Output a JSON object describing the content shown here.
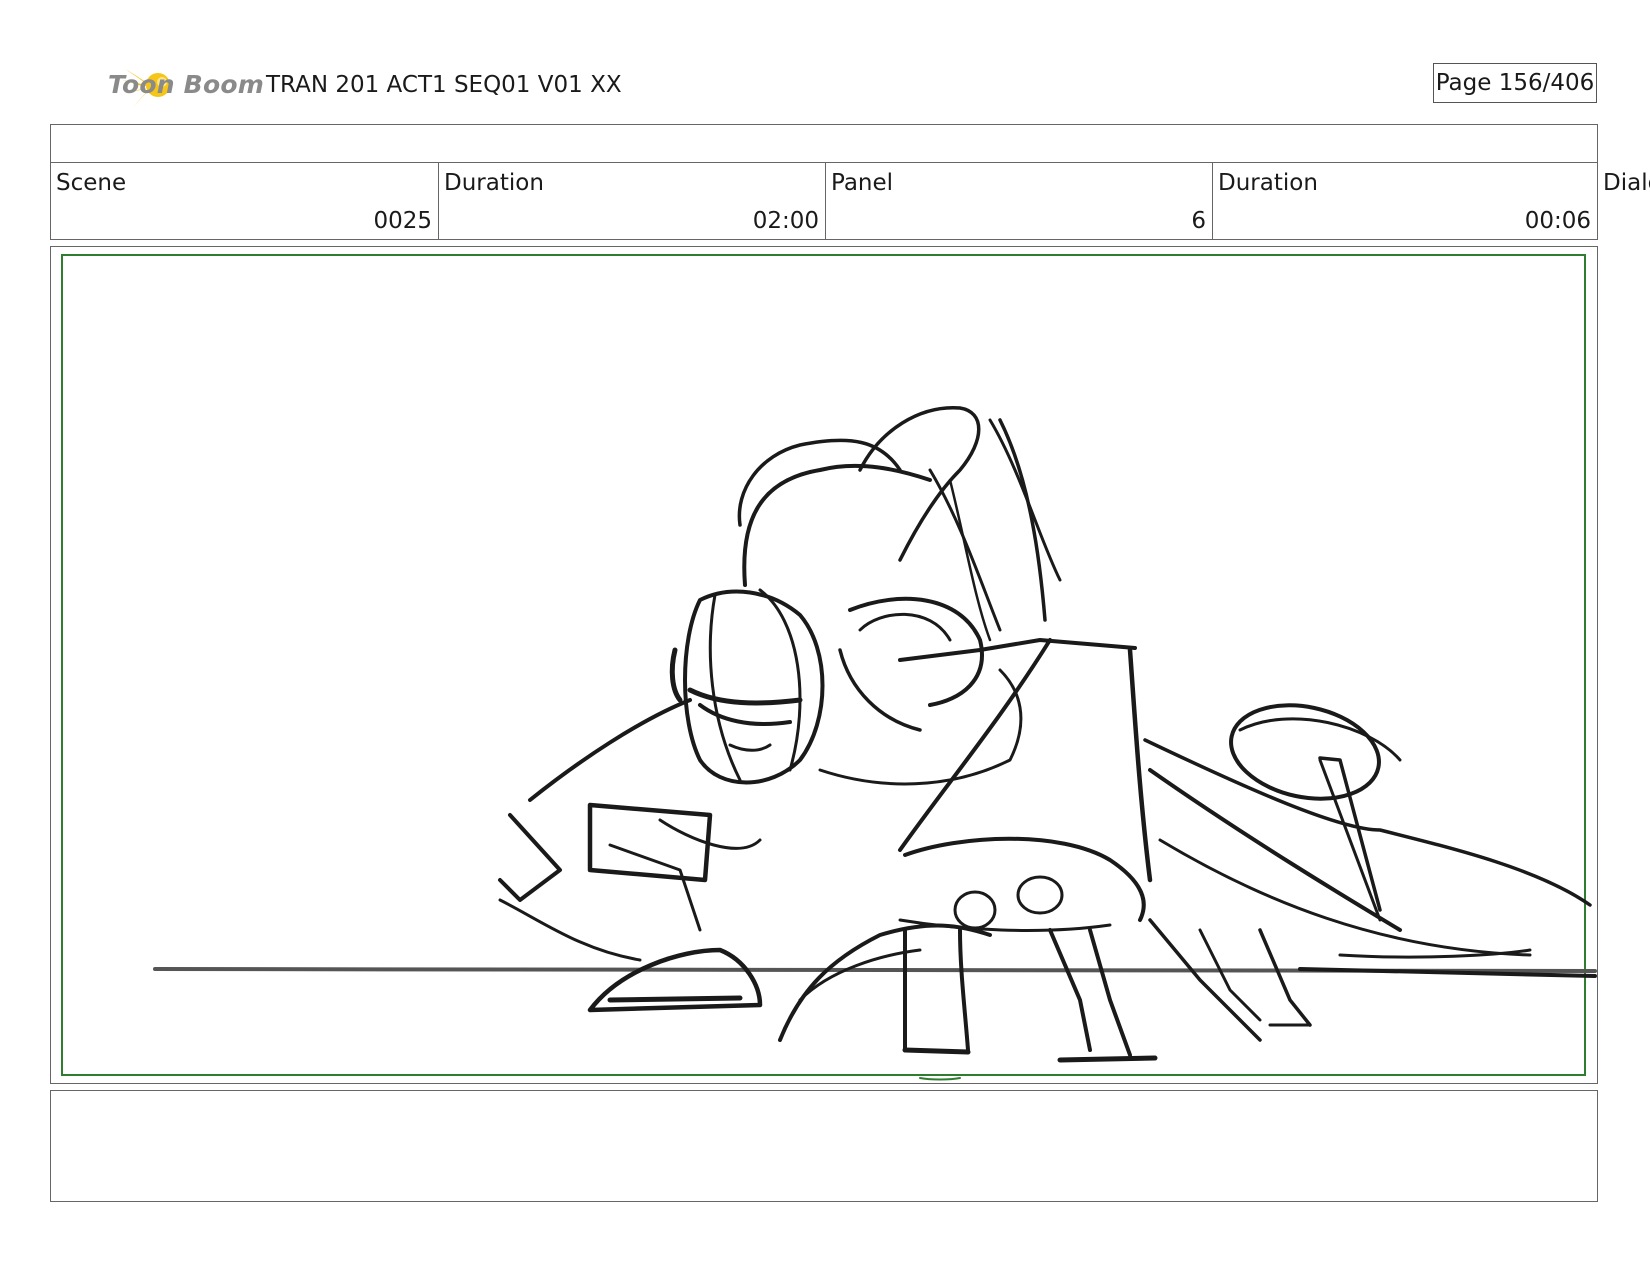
{
  "header": {
    "logo_text": "Toon Boom",
    "title": "TRAN 201 ACT1 SEQ01 V01 XX",
    "page": "Page 156/406"
  },
  "fields": {
    "scene_label": "Scene",
    "scene_value": "0025",
    "scene_duration_label": "Duration",
    "scene_duration_value": "02:00",
    "panel_label": "Panel",
    "panel_value": "6",
    "panel_duration_label": "Duration",
    "panel_duration_value": "00:06",
    "dialog_label": "Dialo"
  },
  "colors": {
    "logo_star": "#f5c518",
    "logo_text": "#8a8a8a",
    "safe_frame": "#2f7d2f",
    "border": "#666666",
    "ink": "#1a1a1a"
  }
}
